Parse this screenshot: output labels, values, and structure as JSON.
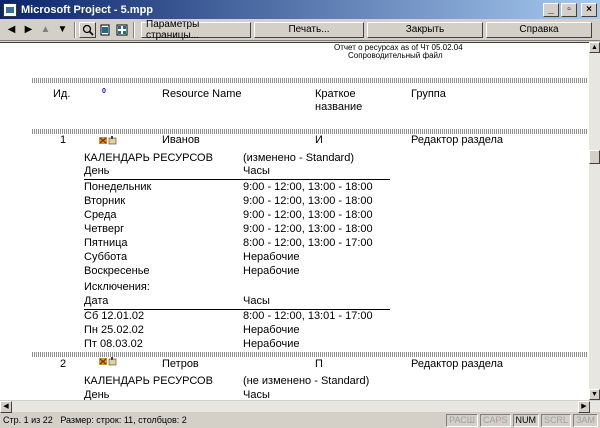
{
  "window": {
    "title": "Microsoft Project - 5.mpp"
  },
  "toolbar": {
    "page_setup": "Параметры страницы...",
    "print": "Печать...",
    "close": "Закрыть",
    "help": "Справка"
  },
  "report": {
    "title": "Отчет о ресурсах as of Чт 05.02.04",
    "subtitle": "Сопроводительный файл"
  },
  "table": {
    "headers": {
      "id": "Ид.",
      "info": "0",
      "name": "Resource Name",
      "short_1": "Краткое",
      "short_2": "название",
      "group": "Группа"
    }
  },
  "resources": [
    {
      "id": "1",
      "name": "Иванов",
      "initials": "И",
      "group": "Редактор раздела",
      "calendar_label": "КАЛЕНДАРЬ РЕСУРСОВ",
      "calendar_status": "(изменено - Standard)",
      "col_day": "День",
      "col_hours": "Часы",
      "days": [
        {
          "day": "Понедельник",
          "hours": "9:00 - 12:00, 13:00 - 18:00"
        },
        {
          "day": "Вторник",
          "hours": "9:00 - 12:00, 13:00 - 18:00"
        },
        {
          "day": "Среда",
          "hours": "9:00 - 12:00, 13:00 - 18:00"
        },
        {
          "day": "Четверг",
          "hours": "9:00 - 12:00, 13:00 - 18:00"
        },
        {
          "day": "Пятница",
          "hours": "8:00 - 12:00, 13:00 - 17:00"
        },
        {
          "day": "Суббота",
          "hours": "Нерабочие"
        },
        {
          "day": "Воскресенье",
          "hours": "Нерабочие"
        }
      ],
      "exceptions_label": "Исключения:",
      "col_date": "Дата",
      "col_ex_hours": "Часы",
      "exceptions": [
        {
          "date": "Сб 12.01.02",
          "hours": "8:00 - 12:00, 13:01 - 17:00"
        },
        {
          "date": "Пн 25.02.02",
          "hours": "Нерабочие"
        },
        {
          "date": "Пт 08.03.02",
          "hours": "Нерабочие"
        }
      ]
    },
    {
      "id": "2",
      "name": "Петров",
      "initials": "П",
      "group": "Редактор раздела",
      "calendar_label": "КАЛЕНДАРЬ РЕСУРСОВ",
      "calendar_status": "(не изменено - Standard)",
      "col_day": "День",
      "col_hours": "Часы"
    }
  ],
  "statusbar": {
    "page_info": "Стр. 1 из 22",
    "size_info": "Размер: строк: 11, столбцов: 2",
    "indicators": [
      "РАСШ",
      "CAPS",
      "NUM",
      "SCRL",
      "ЗАМ"
    ]
  },
  "colors": {
    "title_start": "#0a246a",
    "title_end": "#a6caf0",
    "info_icon": "#1010e0"
  }
}
